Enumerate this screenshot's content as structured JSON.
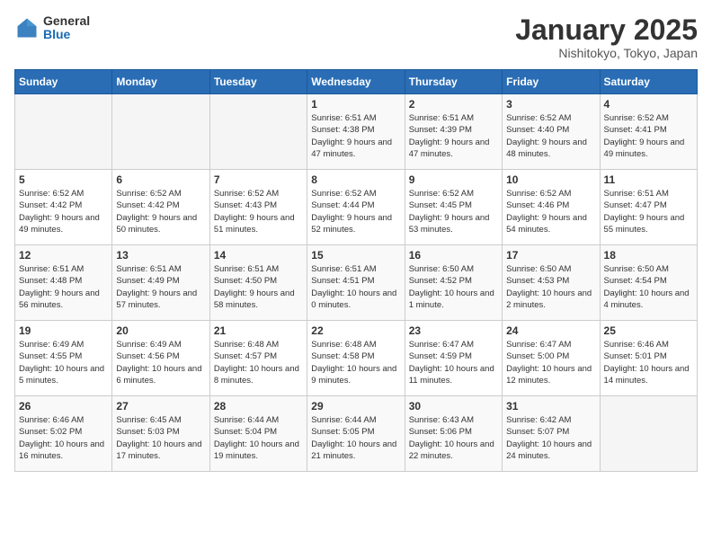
{
  "header": {
    "logo_general": "General",
    "logo_blue": "Blue",
    "title": "January 2025",
    "subtitle": "Nishitokyo, Tokyo, Japan"
  },
  "weekdays": [
    "Sunday",
    "Monday",
    "Tuesday",
    "Wednesday",
    "Thursday",
    "Friday",
    "Saturday"
  ],
  "weeks": [
    [
      {
        "day": "",
        "info": ""
      },
      {
        "day": "",
        "info": ""
      },
      {
        "day": "",
        "info": ""
      },
      {
        "day": "1",
        "info": "Sunrise: 6:51 AM\nSunset: 4:38 PM\nDaylight: 9 hours and 47 minutes."
      },
      {
        "day": "2",
        "info": "Sunrise: 6:51 AM\nSunset: 4:39 PM\nDaylight: 9 hours and 47 minutes."
      },
      {
        "day": "3",
        "info": "Sunrise: 6:52 AM\nSunset: 4:40 PM\nDaylight: 9 hours and 48 minutes."
      },
      {
        "day": "4",
        "info": "Sunrise: 6:52 AM\nSunset: 4:41 PM\nDaylight: 9 hours and 49 minutes."
      }
    ],
    [
      {
        "day": "5",
        "info": "Sunrise: 6:52 AM\nSunset: 4:42 PM\nDaylight: 9 hours and 49 minutes."
      },
      {
        "day": "6",
        "info": "Sunrise: 6:52 AM\nSunset: 4:42 PM\nDaylight: 9 hours and 50 minutes."
      },
      {
        "day": "7",
        "info": "Sunrise: 6:52 AM\nSunset: 4:43 PM\nDaylight: 9 hours and 51 minutes."
      },
      {
        "day": "8",
        "info": "Sunrise: 6:52 AM\nSunset: 4:44 PM\nDaylight: 9 hours and 52 minutes."
      },
      {
        "day": "9",
        "info": "Sunrise: 6:52 AM\nSunset: 4:45 PM\nDaylight: 9 hours and 53 minutes."
      },
      {
        "day": "10",
        "info": "Sunrise: 6:52 AM\nSunset: 4:46 PM\nDaylight: 9 hours and 54 minutes."
      },
      {
        "day": "11",
        "info": "Sunrise: 6:51 AM\nSunset: 4:47 PM\nDaylight: 9 hours and 55 minutes."
      }
    ],
    [
      {
        "day": "12",
        "info": "Sunrise: 6:51 AM\nSunset: 4:48 PM\nDaylight: 9 hours and 56 minutes."
      },
      {
        "day": "13",
        "info": "Sunrise: 6:51 AM\nSunset: 4:49 PM\nDaylight: 9 hours and 57 minutes."
      },
      {
        "day": "14",
        "info": "Sunrise: 6:51 AM\nSunset: 4:50 PM\nDaylight: 9 hours and 58 minutes."
      },
      {
        "day": "15",
        "info": "Sunrise: 6:51 AM\nSunset: 4:51 PM\nDaylight: 10 hours and 0 minutes."
      },
      {
        "day": "16",
        "info": "Sunrise: 6:50 AM\nSunset: 4:52 PM\nDaylight: 10 hours and 1 minute."
      },
      {
        "day": "17",
        "info": "Sunrise: 6:50 AM\nSunset: 4:53 PM\nDaylight: 10 hours and 2 minutes."
      },
      {
        "day": "18",
        "info": "Sunrise: 6:50 AM\nSunset: 4:54 PM\nDaylight: 10 hours and 4 minutes."
      }
    ],
    [
      {
        "day": "19",
        "info": "Sunrise: 6:49 AM\nSunset: 4:55 PM\nDaylight: 10 hours and 5 minutes."
      },
      {
        "day": "20",
        "info": "Sunrise: 6:49 AM\nSunset: 4:56 PM\nDaylight: 10 hours and 6 minutes."
      },
      {
        "day": "21",
        "info": "Sunrise: 6:48 AM\nSunset: 4:57 PM\nDaylight: 10 hours and 8 minutes."
      },
      {
        "day": "22",
        "info": "Sunrise: 6:48 AM\nSunset: 4:58 PM\nDaylight: 10 hours and 9 minutes."
      },
      {
        "day": "23",
        "info": "Sunrise: 6:47 AM\nSunset: 4:59 PM\nDaylight: 10 hours and 11 minutes."
      },
      {
        "day": "24",
        "info": "Sunrise: 6:47 AM\nSunset: 5:00 PM\nDaylight: 10 hours and 12 minutes."
      },
      {
        "day": "25",
        "info": "Sunrise: 6:46 AM\nSunset: 5:01 PM\nDaylight: 10 hours and 14 minutes."
      }
    ],
    [
      {
        "day": "26",
        "info": "Sunrise: 6:46 AM\nSunset: 5:02 PM\nDaylight: 10 hours and 16 minutes."
      },
      {
        "day": "27",
        "info": "Sunrise: 6:45 AM\nSunset: 5:03 PM\nDaylight: 10 hours and 17 minutes."
      },
      {
        "day": "28",
        "info": "Sunrise: 6:44 AM\nSunset: 5:04 PM\nDaylight: 10 hours and 19 minutes."
      },
      {
        "day": "29",
        "info": "Sunrise: 6:44 AM\nSunset: 5:05 PM\nDaylight: 10 hours and 21 minutes."
      },
      {
        "day": "30",
        "info": "Sunrise: 6:43 AM\nSunset: 5:06 PM\nDaylight: 10 hours and 22 minutes."
      },
      {
        "day": "31",
        "info": "Sunrise: 6:42 AM\nSunset: 5:07 PM\nDaylight: 10 hours and 24 minutes."
      },
      {
        "day": "",
        "info": ""
      }
    ]
  ]
}
